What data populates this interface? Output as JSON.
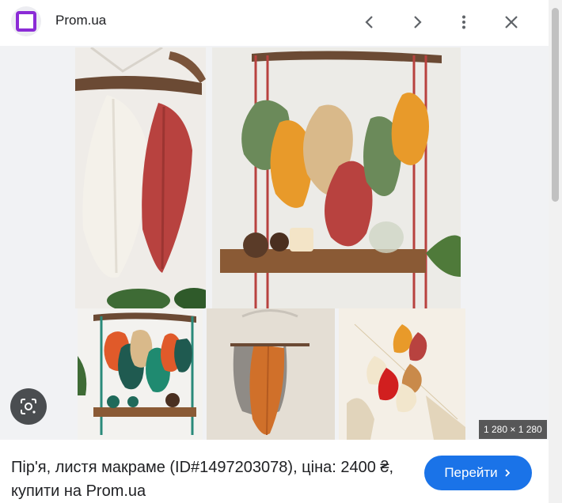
{
  "header": {
    "site_name": "Prom.ua",
    "site_icon": "prom-logo-icon",
    "buttons": [
      "chevron-left-icon",
      "chevron-right-icon",
      "more-vert-icon",
      "close-icon"
    ]
  },
  "image": {
    "dimensions_label": "1 280 × 1 280",
    "lens_icon": "google-lens-icon"
  },
  "footer": {
    "caption": "Пір'я, листя макраме (ID#1497203078), ціна: 2400 ₴, купити на Prom.ua",
    "button_label": "Перейти",
    "button_icon": "chevron-right-icon"
  },
  "colors": {
    "accent": "#1a73e8",
    "brand": "#8b2bd6"
  }
}
